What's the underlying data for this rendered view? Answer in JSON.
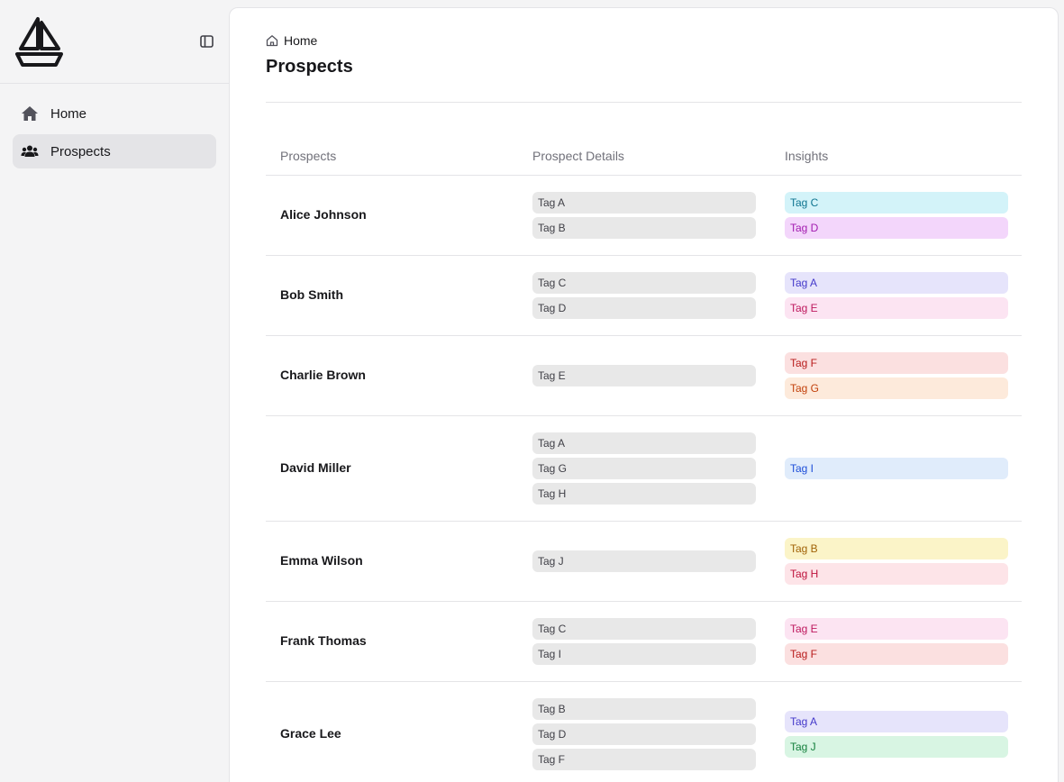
{
  "sidebar": {
    "items": [
      {
        "label": "Home",
        "icon": "home-icon",
        "active": false
      },
      {
        "label": "Prospects",
        "icon": "users-icon",
        "active": true
      }
    ]
  },
  "header": {
    "breadcrumb": "Home",
    "title": "Prospects"
  },
  "table": {
    "columns": [
      "Prospects",
      "Prospect Details",
      "Insights"
    ],
    "rows": [
      {
        "name": "Alice Johnson",
        "details": [
          "Tag A",
          "Tag B"
        ],
        "insights": [
          {
            "label": "Tag C",
            "bg": "#d3f3f9",
            "fg": "#0e7490"
          },
          {
            "label": "Tag D",
            "bg": "#f3d6fb",
            "fg": "#a21caf"
          }
        ]
      },
      {
        "name": "Bob Smith",
        "details": [
          "Tag C",
          "Tag D"
        ],
        "insights": [
          {
            "label": "Tag A",
            "bg": "#e6e4fb",
            "fg": "#4338ca"
          },
          {
            "label": "Tag E",
            "bg": "#fce4f2",
            "fg": "#be185d"
          }
        ]
      },
      {
        "name": "Charlie Brown",
        "details": [
          "Tag E"
        ],
        "insights": [
          {
            "label": "Tag F",
            "bg": "#fbe0e0",
            "fg": "#b91c1c"
          },
          {
            "label": "Tag G",
            "bg": "#fdeadb",
            "fg": "#c2410c"
          }
        ]
      },
      {
        "name": "David Miller",
        "details": [
          "Tag A",
          "Tag G",
          "Tag H"
        ],
        "insights": [
          {
            "label": "Tag I",
            "bg": "#e0ecfb",
            "fg": "#1d4ed8"
          }
        ]
      },
      {
        "name": "Emma Wilson",
        "details": [
          "Tag J"
        ],
        "insights": [
          {
            "label": "Tag B",
            "bg": "#fbf4c8",
            "fg": "#a16207"
          },
          {
            "label": "Tag H",
            "bg": "#fde4e8",
            "fg": "#be123c"
          }
        ]
      },
      {
        "name": "Frank Thomas",
        "details": [
          "Tag C",
          "Tag I"
        ],
        "insights": [
          {
            "label": "Tag E",
            "bg": "#fce4f2",
            "fg": "#be185d"
          },
          {
            "label": "Tag F",
            "bg": "#fbe0e0",
            "fg": "#b91c1c"
          }
        ]
      },
      {
        "name": "Grace Lee",
        "details": [
          "Tag B",
          "Tag D",
          "Tag F"
        ],
        "insights": [
          {
            "label": "Tag A",
            "bg": "#e6e4fb",
            "fg": "#4338ca"
          },
          {
            "label": "Tag J",
            "bg": "#d8f5e3",
            "fg": "#15803d"
          }
        ]
      }
    ]
  },
  "colors": {
    "background": "#f4f4f5",
    "active_nav": "#e4e4e7",
    "gray_tag": "#e8e8e8"
  }
}
